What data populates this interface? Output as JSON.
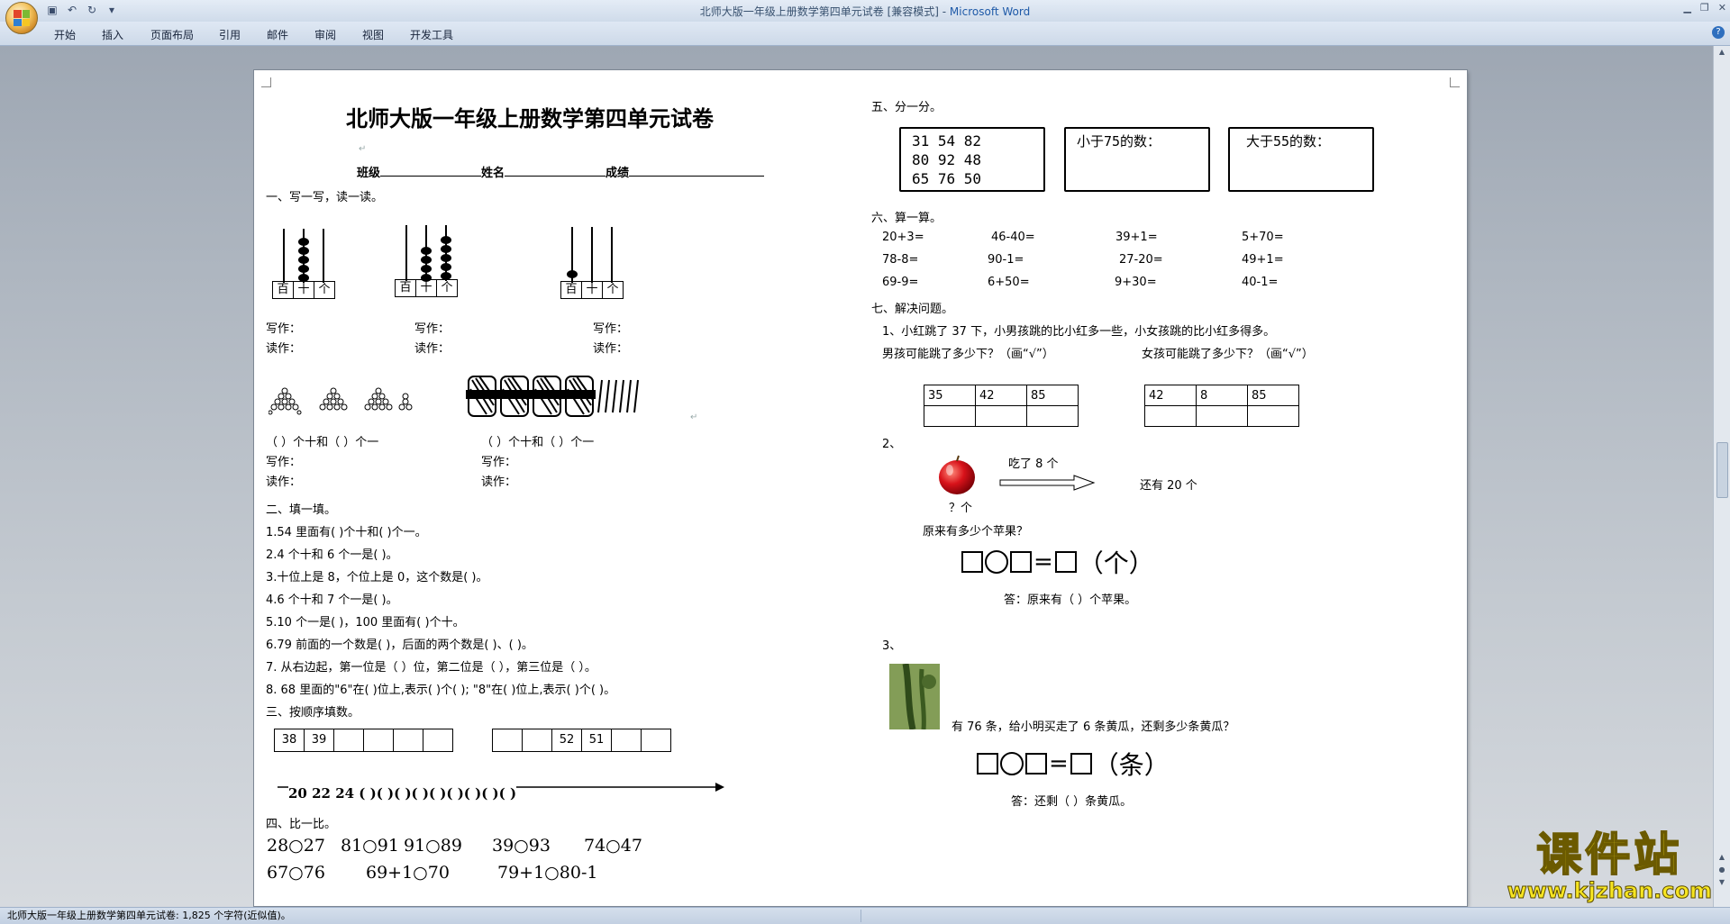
{
  "window": {
    "title_doc": "北师大版一年级上册数学第四单元试卷 [兼容模式] - ",
    "title_app": "Microsoft Word"
  },
  "ribbon": {
    "tabs": [
      "开始",
      "插入",
      "页面布局",
      "引用",
      "邮件",
      "审阅",
      "视图",
      "开发工具"
    ]
  },
  "doc": {
    "title": "北师大版一年级上册数学第四单元试卷",
    "class_label": "班级",
    "name_label": "姓名",
    "score_label": "成绩",
    "s1": "一、写一写，读一读。",
    "abacus_place": [
      "百",
      "十",
      "个"
    ],
    "write_label": "写作：",
    "read_label": "读作：",
    "tens_ones_1": "（      ）个十和（      ）个一",
    "tens_ones_2": "（      ）个十和（      ）个一",
    "s2": "二、填一填。",
    "fill": [
      "1.54 里面有(        )个十和(     )个一。",
      "2.4 个十和 6 个一是(     )。",
      "3.十位上是 8，个位上是 0，这个数是(         )。",
      "4.6 个十和 7 个一是(     )。",
      "5.10 个一是(        )，100 里面有(    )个十。",
      "6.79 前面的一个数是(            )，后面的两个数是(      )、(          )。",
      "7. 从右边起，第一位是（      ）位，第二位是（      ），第三位是（      ）。",
      "8. 68 里面的\"6\"在(     )位上,表示(     )个(     ); \"8\"在(     )位上,表示(     )个(     )。"
    ],
    "s3": "三、按顺序填数。",
    "seq1": [
      "38",
      "39",
      "",
      "",
      "",
      ""
    ],
    "seq2": [
      "",
      "",
      "52",
      "51",
      "",
      ""
    ],
    "numline": "20  22  24 (    )(    )(    )(    )(    )(    )(    )(    )(    )",
    "s4": "四、比一比。",
    "cmp1": [
      "28○27",
      "81○91",
      "91○89",
      "39○93",
      "74○47"
    ],
    "cmp2": [
      "67○76",
      "69+1○70",
      "79+1○80-1"
    ],
    "s5": "五、分一分。",
    "numbers": [
      "31   54   82",
      "80   92   48",
      "65   76   50"
    ],
    "less75": "小于75的数：",
    "more55": "大于55的数：",
    "s6": "六、算一算。",
    "calc": [
      [
        "20+3=",
        "46-40=",
        "39+1=",
        "5+70="
      ],
      [
        "78-8=",
        "90-1=",
        "27-20=",
        "49+1="
      ],
      [
        "69-9=",
        "6+50=",
        "9+30=",
        "40-1="
      ]
    ],
    "s7": "七、解决问题。",
    "q1": "1、小红跳了 37 下，小男孩跳的比小红多一些，小女孩跳的比小红多得多。",
    "q1_boy": "男孩可能跳了多少下？（画“√”）",
    "q1_girl": "女孩可能跳了多少下？（画“√”）",
    "boy_opts": [
      "35",
      "42",
      "85"
    ],
    "girl_opts": [
      "42",
      "8",
      "85"
    ],
    "q2": "2、",
    "q2_ate": "吃了 8 个",
    "q2_left": "还有 20 个",
    "q2_q": "？个",
    "q2_ask": "原来有多少个苹果？",
    "q2_unit": "（个）",
    "q2_ans": "答：原来有（     ）个苹果。",
    "q3": "3、",
    "q3_text": "有 76 条，给小明买走了 6 条黄瓜，还剩多少条黄瓜？",
    "q3_unit": "（条）",
    "q3_ans": "答：还剩（     ）条黄瓜。"
  },
  "status": {
    "text": "北师大版一年级上册数学第四单元试卷: 1,825 个字符(近似值)。"
  },
  "watermark": {
    "cn": "课件站",
    "url": "www.kjzhan.com"
  }
}
